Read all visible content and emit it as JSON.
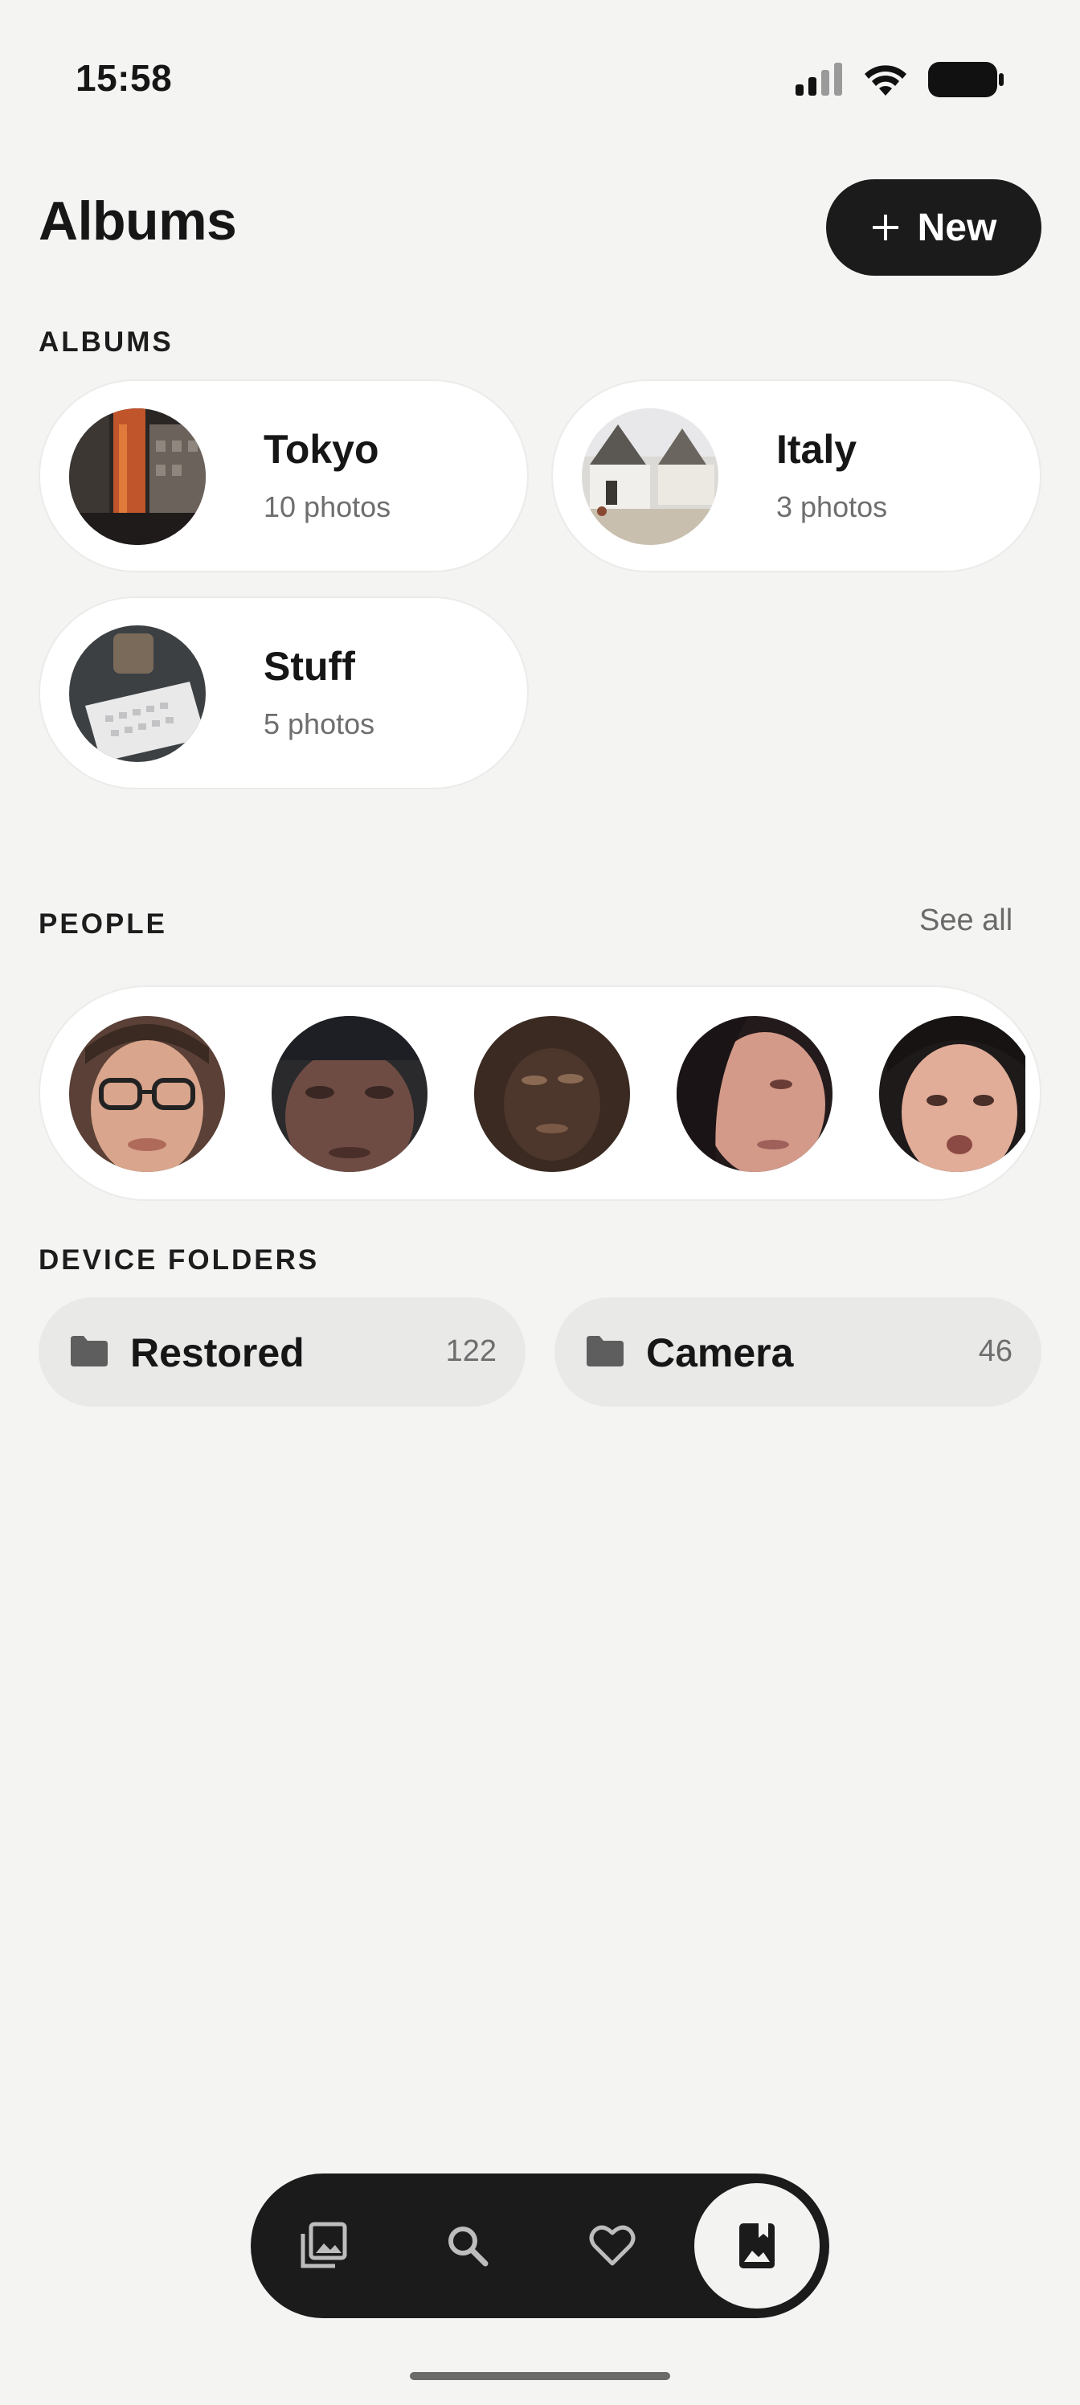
{
  "status_bar": {
    "time": "15:58",
    "icons": [
      "cellular-signal-icon",
      "wifi-icon",
      "battery-icon"
    ]
  },
  "header": {
    "title": "Albums",
    "new_button_label": "New",
    "new_button_icon": "plus-icon"
  },
  "albums": {
    "section_label": "ALBUMS",
    "items": [
      {
        "name": "Tokyo",
        "count": "10 photos",
        "thumb": "tokyo-building-photo"
      },
      {
        "name": "Italy",
        "count": "3 photos",
        "thumb": "italy-street-photo"
      },
      {
        "name": "Stuff",
        "count": "5 photos",
        "thumb": "keyboard-desk-photo"
      }
    ]
  },
  "people": {
    "section_label": "PEOPLE",
    "see_all_label": "See all",
    "faces": [
      "person-1",
      "person-2",
      "person-3",
      "person-4",
      "person-5"
    ]
  },
  "device_folders": {
    "section_label": "DEVICE FOLDERS",
    "items": [
      {
        "name": "Restored",
        "count": "122",
        "icon": "folder-icon"
      },
      {
        "name": "Camera",
        "count": "46",
        "icon": "folder-icon"
      }
    ]
  },
  "bottom_nav": {
    "items": [
      {
        "icon": "photos-icon",
        "active": false
      },
      {
        "icon": "search-icon",
        "active": false
      },
      {
        "icon": "heart-icon",
        "active": false
      },
      {
        "icon": "albums-icon",
        "active": true
      }
    ]
  },
  "colors": {
    "background": "#f4f4f3",
    "card": "#ffffff",
    "dark": "#1b1b1b",
    "muted_text": "#6e6e6e",
    "chip": "#e9e9e8"
  }
}
